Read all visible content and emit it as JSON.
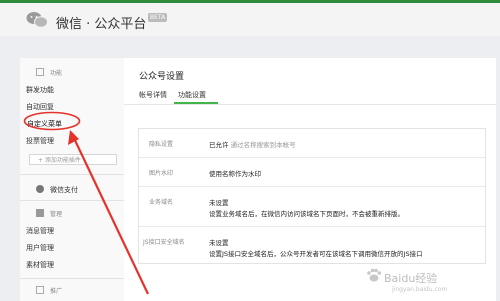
{
  "header": {
    "brand": "微信 · 公众平台",
    "badge": "BETA"
  },
  "sidebar": {
    "section_function": "功能",
    "function_items": [
      "群发功能",
      "自动回复",
      "自定义菜单",
      "投票管理"
    ],
    "add_plugin": "+ 添加功能插件",
    "section_pay": "微信支付",
    "section_manage": "管理",
    "manage_items": [
      "消息管理",
      "用户管理",
      "素材管理"
    ],
    "section_promo": "推广"
  },
  "main": {
    "title": "公众号设置",
    "tabs": [
      "帐号详情",
      "功能设置"
    ],
    "rows": [
      {
        "label": "隐私设置",
        "value": "已允许",
        "note": "通过名称搜索到本帐号"
      },
      {
        "label": "图片水印",
        "value": "使用名称作为水印"
      },
      {
        "label": "业务域名",
        "value": "未设置",
        "note": "设置业务域名后，在微信内访问该域名下页面时，不会被重新排版。"
      },
      {
        "label": "JS接口安全域名",
        "value": "未设置",
        "note": "设置JS接口安全域名后，公众号开发者可在该域名下调用微信开放的JS接口"
      }
    ]
  },
  "watermark": {
    "text": "Baidu经验",
    "url": "jingyan.baidu.com"
  },
  "colors": {
    "accent": "#44b549",
    "annotation": "#e5332a",
    "topbar_border": "#2f8c3f"
  }
}
